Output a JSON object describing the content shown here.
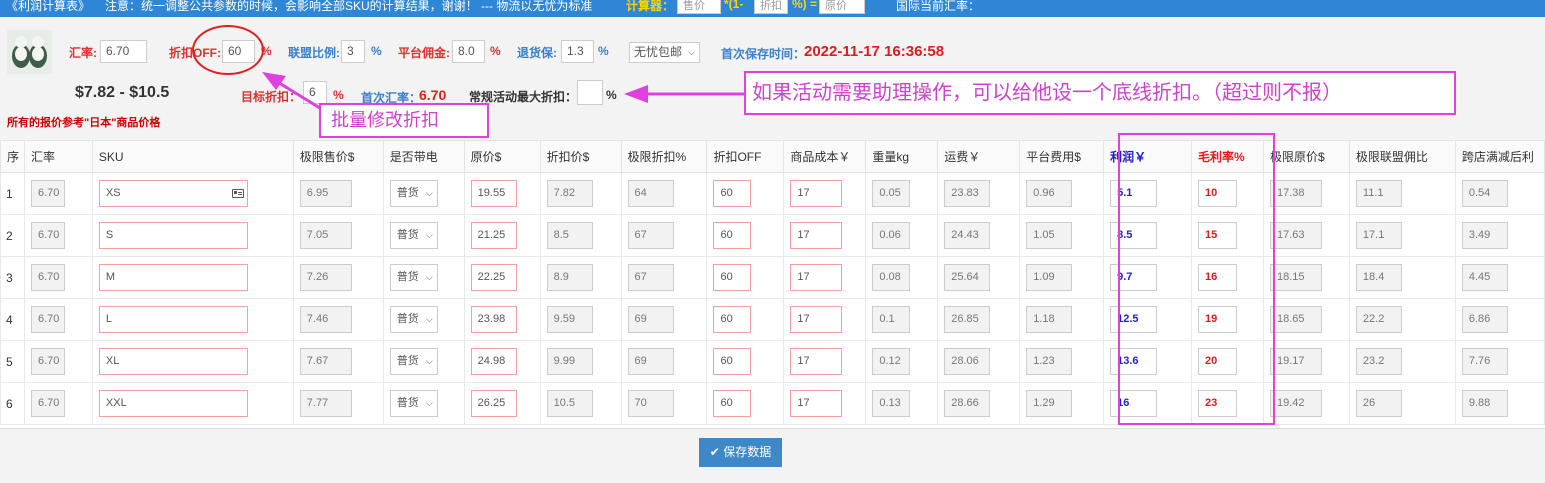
{
  "topbar": {
    "title": "《利润计算表》",
    "warning": "注意：统一调整公共参数的时候，会影响全部SKU的计算结果，谢谢！ --- 物流以无忧为标准",
    "calc_label": "计算器：",
    "calc_input1_placeholder": "售价",
    "calc_op1": "*(1-",
    "calc_input2_placeholder": "折扣",
    "calc_op2": "%) =",
    "calc_input3_placeholder": "原价",
    "rate_label": "国际当前汇率："
  },
  "settings": {
    "exchange_rate_label": "汇率:",
    "exchange_rate_value": "6.70",
    "discount_off_label": "折扣OFF:",
    "discount_off_value": "60",
    "alliance_ratio_label": "联盟比例:",
    "alliance_ratio_value": "3",
    "platform_commission_label": "平台佣金:",
    "platform_commission_value": "8.0",
    "return_insurance_label": "退货保:",
    "return_insurance_value": "1.3",
    "shipping_select_value": "无忧包邮",
    "first_save_time_label": "首次保存时间：",
    "first_save_time_value": "2022-11-17 16:36:58",
    "price_range": "$7.82 - $10.5",
    "target_discount_label": "目标折扣：",
    "target_discount_value": "6",
    "first_rate_label": "首次汇率：",
    "first_rate_value": "6.70",
    "max_discount_label": "常规活动最大折扣：",
    "max_discount_value": "",
    "percent": "%",
    "japan_note": "所有的报价参考\"日本\"商品价格"
  },
  "annotations": {
    "batch_discount": "批量修改折扣",
    "floor_discount": "如果活动需要助理操作，可以给他设一个底线折扣。（超过则不报）"
  },
  "table": {
    "headers": [
      "序",
      "汇率",
      "SKU",
      "极限售价$",
      "是否带电",
      "原价$",
      "折扣价$",
      "极限折扣%",
      "折扣OFF",
      "商品成本￥",
      "重量kg",
      "运费￥",
      "平台费用$",
      "利润￥",
      "毛利率%",
      "极限原价$",
      "极限联盟佣比",
      "跨店满减后利"
    ],
    "rows": [
      [
        "1",
        "6.70",
        "XS",
        "6.95",
        "普货",
        "19.55",
        "7.82",
        "64",
        "60",
        "17",
        "0.05",
        "23.83",
        "0.96",
        "5.1",
        "10",
        "17.38",
        "11.1",
        "0.54"
      ],
      [
        "2",
        "6.70",
        "S",
        "7.05",
        "普货",
        "21.25",
        "8.5",
        "67",
        "60",
        "17",
        "0.06",
        "24.43",
        "1.05",
        "8.5",
        "15",
        "17.63",
        "17.1",
        "3.49"
      ],
      [
        "3",
        "6.70",
        "M",
        "7.26",
        "普货",
        "22.25",
        "8.9",
        "67",
        "60",
        "17",
        "0.08",
        "25.64",
        "1.09",
        "9.7",
        "16",
        "18.15",
        "18.4",
        "4.45"
      ],
      [
        "4",
        "6.70",
        "L",
        "7.46",
        "普货",
        "23.98",
        "9.59",
        "69",
        "60",
        "17",
        "0.1",
        "26.85",
        "1.18",
        "12.5",
        "19",
        "18.65",
        "22.2",
        "6.86"
      ],
      [
        "5",
        "6.70",
        "XL",
        "7.67",
        "普货",
        "24.98",
        "9.99",
        "69",
        "60",
        "17",
        "0.12",
        "28.06",
        "1.23",
        "13.6",
        "20",
        "19.17",
        "23.2",
        "7.76"
      ],
      [
        "6",
        "6.70",
        "XXL",
        "7.77",
        "普货",
        "26.25",
        "10.5",
        "70",
        "60",
        "17",
        "0.13",
        "28.66",
        "1.29",
        "16",
        "23",
        "19.42",
        "26",
        "9.88"
      ]
    ]
  },
  "footer": {
    "save_label": "保存数据"
  },
  "colors": {
    "topbar": "#2f86d6",
    "accent_red": "#e01b1b",
    "accent_blue": "#3a7fd0",
    "profit_blue": "#2222cc",
    "annotation_magenta": "#e040e0",
    "save_button": "#3f88c8"
  }
}
